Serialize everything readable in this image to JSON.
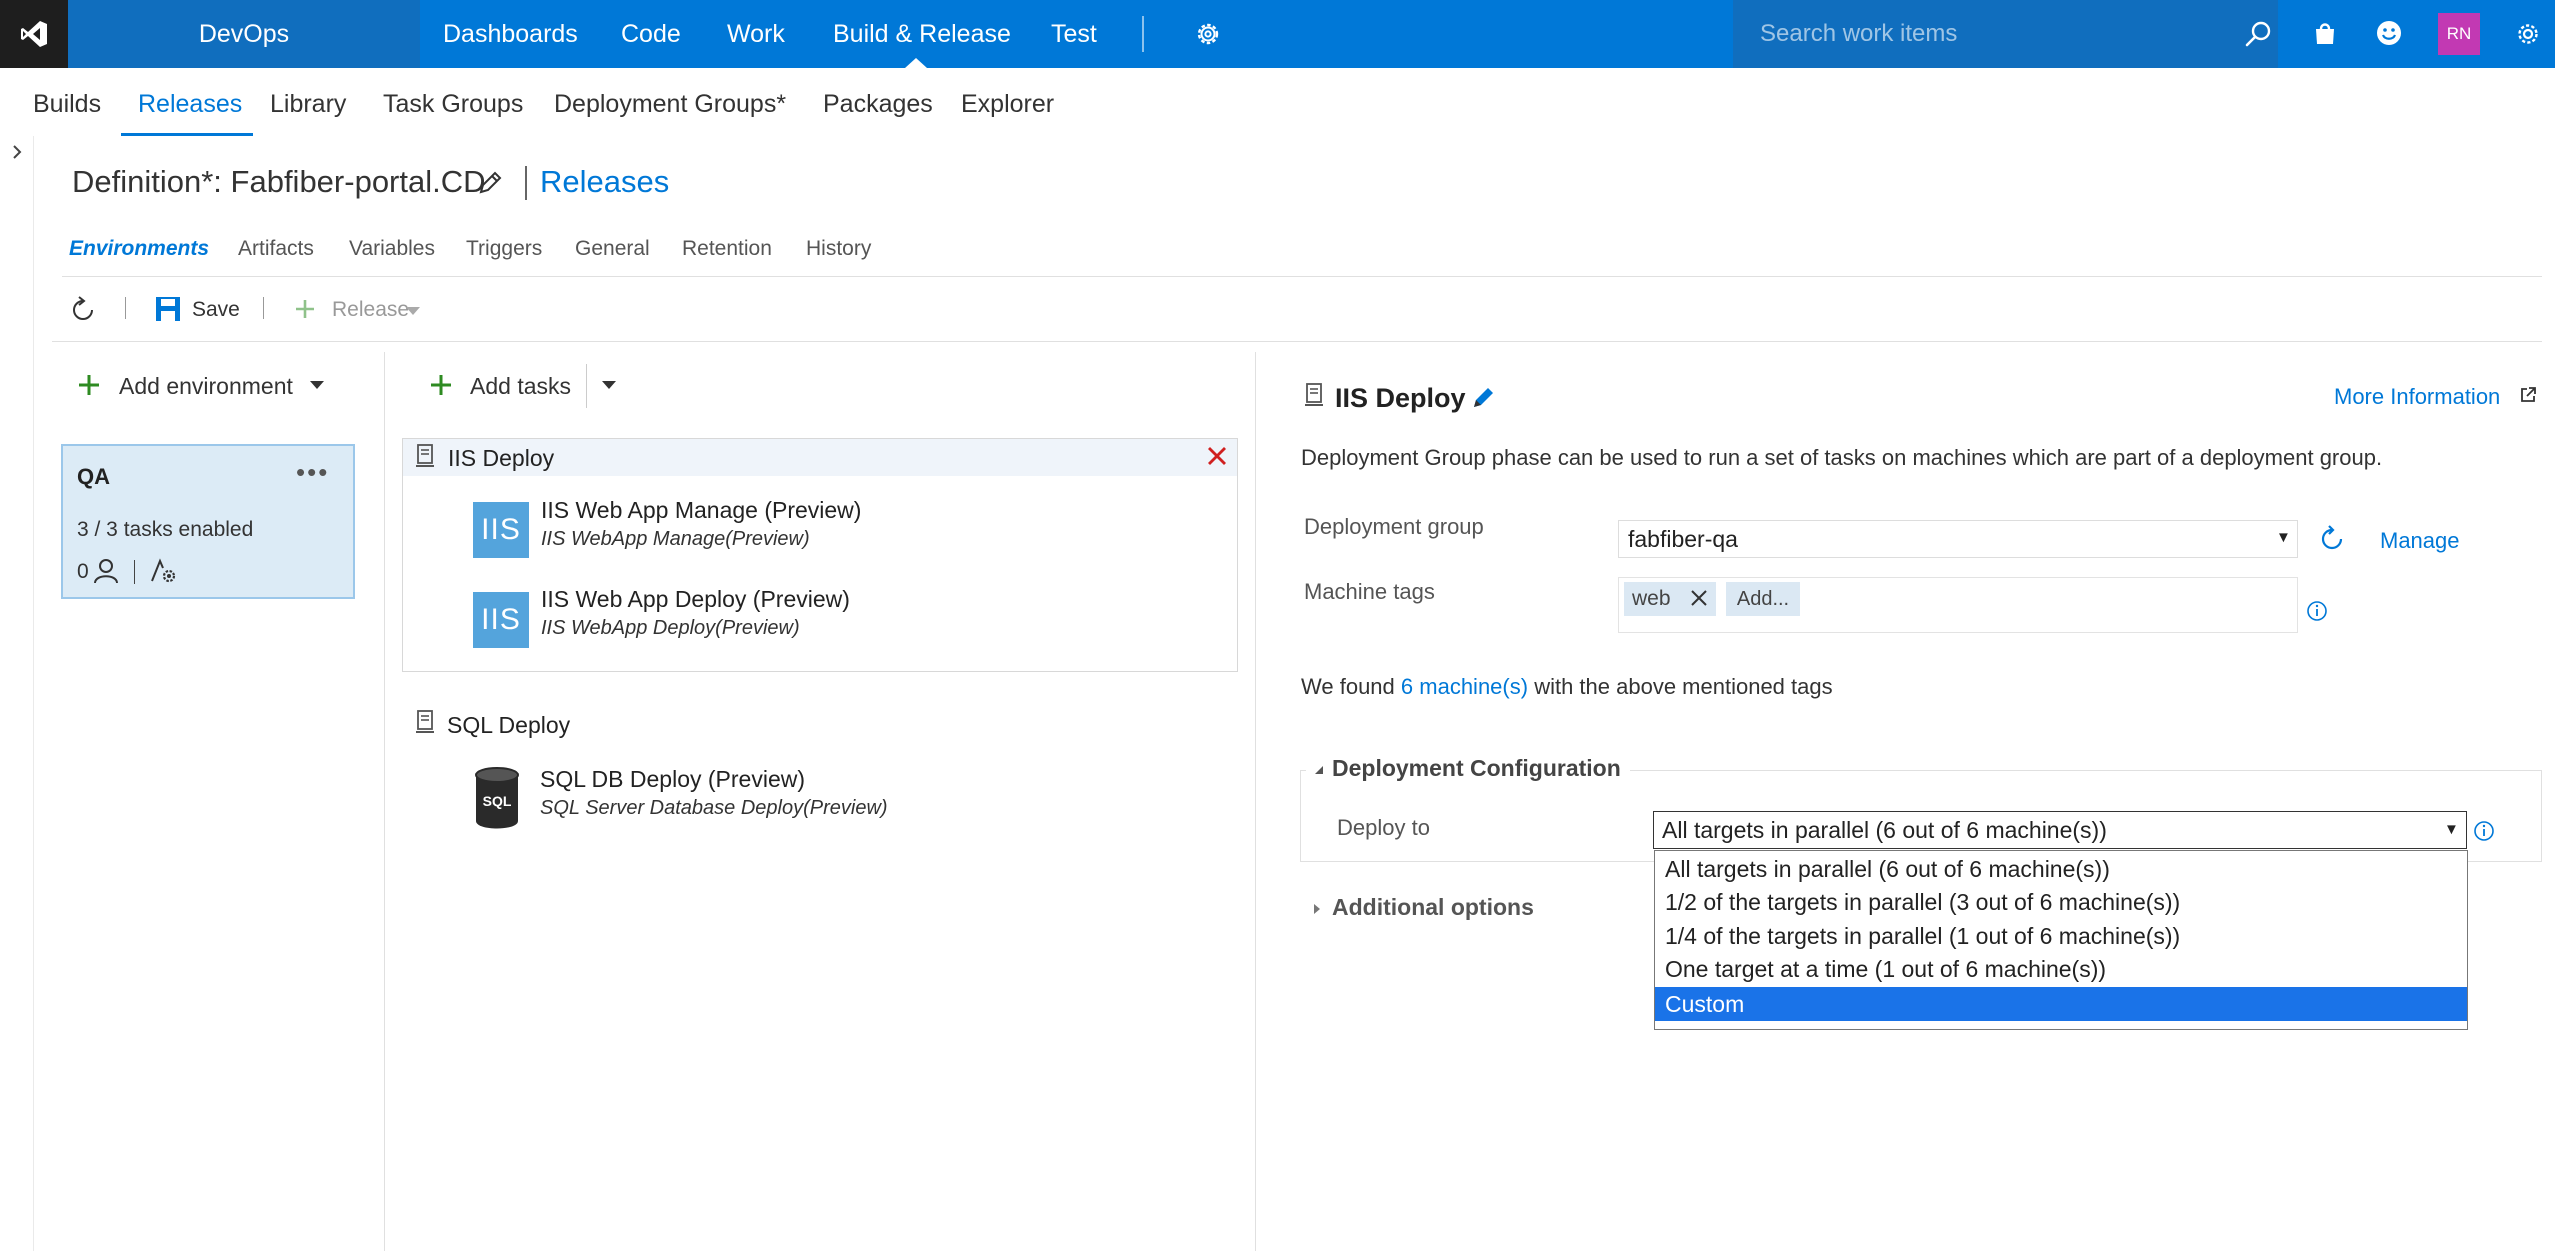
{
  "colors": {
    "accent": "#0078d7",
    "topbar": "#0078d7",
    "selected_option": "#1a73e8",
    "add_green": "#2e8b22",
    "delete_red": "#d02020"
  },
  "brand": {
    "name": "DevOps"
  },
  "topnav": {
    "items": [
      "Dashboards",
      "Code",
      "Work",
      "Build & Release",
      "Test"
    ],
    "active": "Build & Release"
  },
  "search": {
    "placeholder": "Search work items"
  },
  "user": {
    "initials": "RN"
  },
  "hub": {
    "tabs": [
      "Builds",
      "Releases",
      "Library",
      "Task Groups",
      "Deployment Groups*",
      "Packages",
      "Explorer"
    ],
    "active": "Releases"
  },
  "definition": {
    "title": "Definition*: Fabfiber-portal.CD",
    "releases_link": "Releases"
  },
  "pivots": [
    "Environments",
    "Artifacts",
    "Variables",
    "Triggers",
    "General",
    "Retention",
    "History"
  ],
  "toolbar": {
    "save": "Save",
    "release": "Release"
  },
  "environments": {
    "add_label": "Add environment",
    "card": {
      "name": "QA",
      "tasks": "3 / 3 tasks enabled",
      "approvers": "0"
    }
  },
  "tasks_panel": {
    "add_label": "Add tasks",
    "phases": [
      {
        "name": "IIS Deploy",
        "tasks": [
          {
            "name": "IIS Web App Manage (Preview)",
            "sub": "IIS WebApp Manage(Preview)",
            "icon": "IIS"
          },
          {
            "name": "IIS Web App Deploy (Preview)",
            "sub": "IIS WebApp Deploy(Preview)",
            "icon": "IIS"
          }
        ]
      },
      {
        "name": "SQL Deploy",
        "tasks": [
          {
            "name": "SQL DB Deploy (Preview)",
            "sub": "SQL Server Database Deploy(Preview)",
            "icon": "SQL"
          }
        ]
      }
    ]
  },
  "details": {
    "title": "IIS Deploy",
    "more_info": "More Information",
    "description": "Deployment Group phase can be used to run a set of tasks on machines which are part of a deployment group.",
    "deployment_group_label": "Deployment group",
    "deployment_group_value": "fabfiber-qa",
    "manage_label": "Manage",
    "machine_tags_label": "Machine tags",
    "tags": [
      "web"
    ],
    "add_tag_label": "Add...",
    "found_prefix": "We found",
    "found_link": "6 machine(s)",
    "found_suffix": "with the above mentioned tags",
    "deployment_config_label": "Deployment Configuration",
    "deploy_to_label": "Deploy to",
    "deploy_to_value": "All targets in parallel (6 out of 6 machine(s))",
    "additional_options_label": "Additional options",
    "deploy_options": [
      "All targets in parallel (6 out of 6 machine(s))",
      "1/2 of the targets in parallel (3 out of 6 machine(s))",
      "1/4 of the targets in parallel (1 out of 6 machine(s))",
      "One target at a time (1 out of 6 machine(s))",
      "Custom"
    ],
    "highlighted_option": "Custom"
  }
}
